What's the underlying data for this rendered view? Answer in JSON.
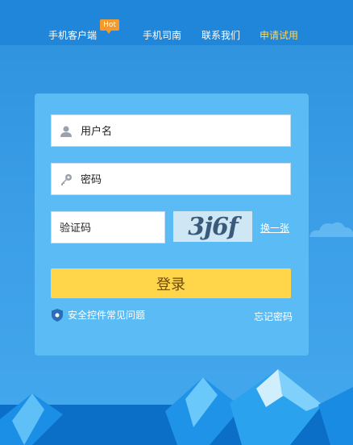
{
  "nav": {
    "items": [
      {
        "label": "手机客户端",
        "badge": "Hot"
      },
      {
        "label": "手机司南"
      },
      {
        "label": "联系我们"
      },
      {
        "label": "申请试用"
      }
    ]
  },
  "login": {
    "username_placeholder": "用户名",
    "password_placeholder": "密码",
    "captcha_placeholder": "验证码",
    "captcha_text": "3j6f",
    "refresh_label": "换一张",
    "submit_label": "登录",
    "security_label": "安全控件常见问题",
    "forgot_label": "忘记密码"
  },
  "colors": {
    "nav_active": "#ffd65a",
    "button": "#ffd54a",
    "card": "#5bbcf5",
    "badge": "#f39a2e"
  }
}
